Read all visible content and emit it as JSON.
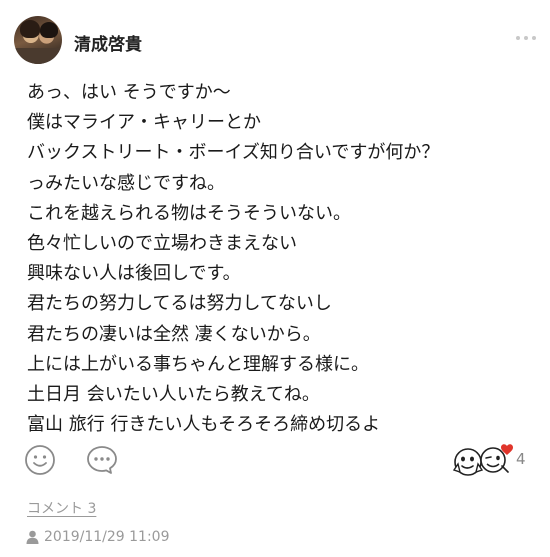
{
  "post": {
    "author": "清成啓貴",
    "lines": [
      "あっ、はい そうですか〜",
      "僕はマライア・キャリーとか",
      "バックストリート・ボーイズ知り合いですが何か？",
      "っみたいな感じですね。",
      "これを越えられる物はそうそういない。",
      "色々忙しいので立場わきまえない",
      "興味ない人は後回しです。",
      "君たちの努力してるは努力してないし",
      "君たちの凄いは全然 凄くないから。",
      "上には上がいる事ちゃんと理解する様に。",
      "土日月 会いたい人いたら教えてね。",
      "富山 旅行 行きたい人もそろそろ締め切るよ"
    ],
    "reaction_count": "4",
    "comments_link": "コメント 3",
    "timestamp": "2019/11/29 11:09"
  },
  "icons": {
    "avatar": "avatar-photo",
    "more": "more-dots-icon",
    "smile": "smile-icon",
    "comment": "comment-bubble-icon",
    "reactions": "reaction-stickers-icon",
    "person": "person-icon"
  },
  "colors": {
    "text": "#1a1a1a",
    "muted": "#9a9a9a",
    "icon": "#8a8a8a",
    "heart": "#e0352b"
  }
}
